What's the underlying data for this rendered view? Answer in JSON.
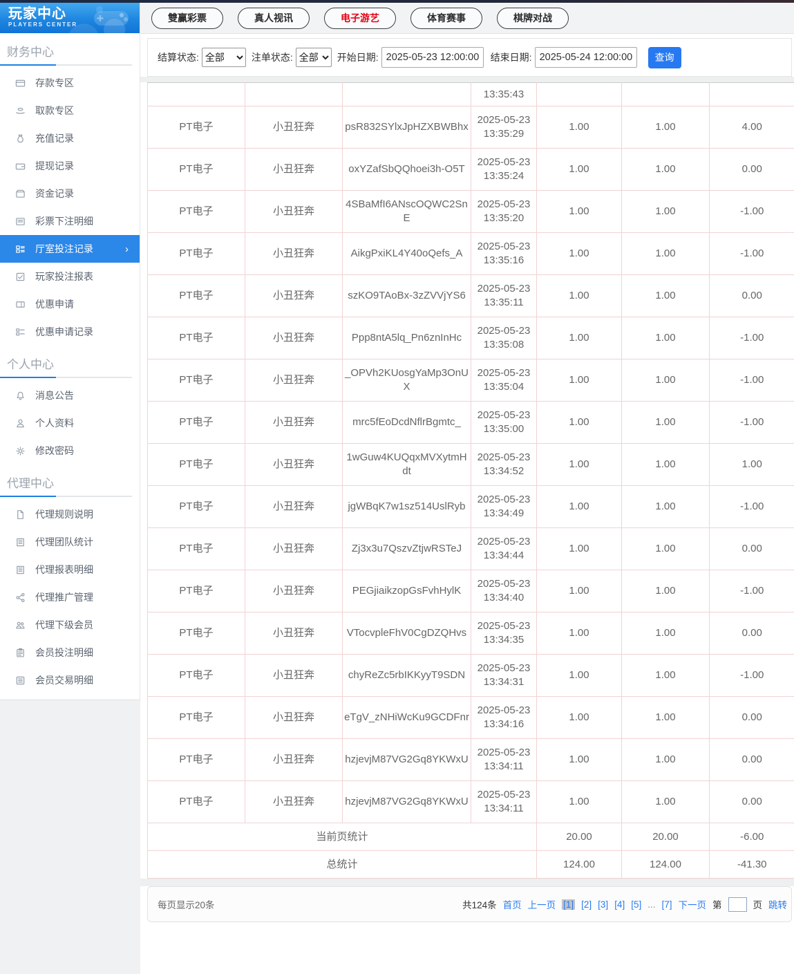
{
  "sidebar": {
    "title": "玩家中心",
    "subtitle": "PLAYERS CENTER",
    "sections": [
      {
        "title": "财务中心",
        "items": [
          {
            "name": "deposit-zone",
            "icon": "bank-card-icon",
            "label": "存款专区"
          },
          {
            "name": "withdraw-zone",
            "icon": "withdraw-hand-icon",
            "label": "取款专区"
          },
          {
            "name": "recharge-records",
            "icon": "money-bag-icon",
            "label": "充值记录"
          },
          {
            "name": "withdraw-records",
            "icon": "wallet-icon",
            "label": "提现记录"
          },
          {
            "name": "funds-records",
            "icon": "funds-icon",
            "label": "资金记录"
          },
          {
            "name": "lottery-bet-details",
            "icon": "lottery-list-icon",
            "label": "彩票下注明细"
          },
          {
            "name": "hall-bet-records",
            "icon": "hall-records-icon",
            "label": "厅室投注记录",
            "active": true
          },
          {
            "name": "player-bet-report",
            "icon": "report-icon",
            "label": "玩家投注报表"
          },
          {
            "name": "promo-apply",
            "icon": "coupon-icon",
            "label": "优惠申请"
          },
          {
            "name": "promo-apply-records",
            "icon": "coupon-record-icon",
            "label": "优惠申请记录"
          }
        ]
      },
      {
        "title": "个人中心",
        "items": [
          {
            "name": "messages",
            "icon": "bell-icon",
            "label": "消息公告"
          },
          {
            "name": "profile",
            "icon": "user-icon",
            "label": "个人资料"
          },
          {
            "name": "change-password",
            "icon": "gear-icon",
            "label": "修改密码"
          }
        ]
      },
      {
        "title": "代理中心",
        "items": [
          {
            "name": "agent-rules",
            "icon": "doc-icon",
            "label": "代理规则说明"
          },
          {
            "name": "agent-team-stats",
            "icon": "building-icon",
            "label": "代理团队统计"
          },
          {
            "name": "agent-report-details",
            "icon": "building-icon",
            "label": "代理报表明细"
          },
          {
            "name": "agent-promotion",
            "icon": "share-icon",
            "label": "代理推广管理"
          },
          {
            "name": "agent-sub-members",
            "icon": "users-icon",
            "label": "代理下级会员"
          },
          {
            "name": "member-bet-details",
            "icon": "clipboard-icon",
            "label": "会员投注明细"
          },
          {
            "name": "member-trade-details",
            "icon": "ledger-icon",
            "label": "会员交易明细"
          }
        ]
      }
    ]
  },
  "tabs": [
    {
      "name": "tab-lottery",
      "label": "雙赢彩票"
    },
    {
      "name": "tab-live-video",
      "label": "真人视讯"
    },
    {
      "name": "tab-electronic-games",
      "label": "电子游艺",
      "active": true
    },
    {
      "name": "tab-sports",
      "label": "体育赛事"
    },
    {
      "name": "tab-board-games",
      "label": "棋牌对战"
    }
  ],
  "filters": {
    "settle_label": "结算状态:",
    "settle_value": "全部",
    "order_label": "注单状态:",
    "order_value": "全部",
    "start_label": "开始日期:",
    "start_value": "2025-05-23 12:00:00",
    "end_label": "结束日期:",
    "end_value": "2025-05-24 12:00:00",
    "search_label": "查询"
  },
  "table": {
    "partial_row_time": "13:35:43",
    "rows": [
      {
        "game": "PT电子",
        "game_name": "小丑狂奔",
        "bet_id": "psR832SYlxJpHZXBWBhx",
        "date": "2025-05-23",
        "time": "13:35:29",
        "amount": "1.00",
        "valid_amount": "1.00",
        "win_loss": "4.00"
      },
      {
        "game": "PT电子",
        "game_name": "小丑狂奔",
        "bet_id": "oxYZafSbQQhoei3h-O5T",
        "date": "2025-05-23",
        "time": "13:35:24",
        "amount": "1.00",
        "valid_amount": "1.00",
        "win_loss": "0.00"
      },
      {
        "game": "PT电子",
        "game_name": "小丑狂奔",
        "bet_id": "4SBaMfI6ANscOQWC2SnE",
        "date": "2025-05-23",
        "time": "13:35:20",
        "amount": "1.00",
        "valid_amount": "1.00",
        "win_loss": "-1.00"
      },
      {
        "game": "PT电子",
        "game_name": "小丑狂奔",
        "bet_id": "AikgPxiKL4Y40oQefs_A",
        "date": "2025-05-23",
        "time": "13:35:16",
        "amount": "1.00",
        "valid_amount": "1.00",
        "win_loss": "-1.00"
      },
      {
        "game": "PT电子",
        "game_name": "小丑狂奔",
        "bet_id": "szKO9TAoBx-3zZVVjYS6",
        "date": "2025-05-23",
        "time": "13:35:11",
        "amount": "1.00",
        "valid_amount": "1.00",
        "win_loss": "0.00"
      },
      {
        "game": "PT电子",
        "game_name": "小丑狂奔",
        "bet_id": "Ppp8ntA5lq_Pn6znInHc",
        "date": "2025-05-23",
        "time": "13:35:08",
        "amount": "1.00",
        "valid_amount": "1.00",
        "win_loss": "-1.00"
      },
      {
        "game": "PT电子",
        "game_name": "小丑狂奔",
        "bet_id": "_OPVh2KUosgYaMp3OnUX",
        "date": "2025-05-23",
        "time": "13:35:04",
        "amount": "1.00",
        "valid_amount": "1.00",
        "win_loss": "-1.00"
      },
      {
        "game": "PT电子",
        "game_name": "小丑狂奔",
        "bet_id": "mrc5fEoDcdNflrBgmtc_",
        "date": "2025-05-23",
        "time": "13:35:00",
        "amount": "1.00",
        "valid_amount": "1.00",
        "win_loss": "-1.00"
      },
      {
        "game": "PT电子",
        "game_name": "小丑狂奔",
        "bet_id": "1wGuw4KUQqxMVXytmHdt",
        "date": "2025-05-23",
        "time": "13:34:52",
        "amount": "1.00",
        "valid_amount": "1.00",
        "win_loss": "1.00"
      },
      {
        "game": "PT电子",
        "game_name": "小丑狂奔",
        "bet_id": "jgWBqK7w1sz514UslRyb",
        "date": "2025-05-23",
        "time": "13:34:49",
        "amount": "1.00",
        "valid_amount": "1.00",
        "win_loss": "-1.00"
      },
      {
        "game": "PT电子",
        "game_name": "小丑狂奔",
        "bet_id": "Zj3x3u7QszvZtjwRSTeJ",
        "date": "2025-05-23",
        "time": "13:34:44",
        "amount": "1.00",
        "valid_amount": "1.00",
        "win_loss": "0.00"
      },
      {
        "game": "PT电子",
        "game_name": "小丑狂奔",
        "bet_id": "PEGjiaikzopGsFvhHylK",
        "date": "2025-05-23",
        "time": "13:34:40",
        "amount": "1.00",
        "valid_amount": "1.00",
        "win_loss": "-1.00"
      },
      {
        "game": "PT电子",
        "game_name": "小丑狂奔",
        "bet_id": "VTocvpleFhV0CgDZQHvs",
        "date": "2025-05-23",
        "time": "13:34:35",
        "amount": "1.00",
        "valid_amount": "1.00",
        "win_loss": "0.00"
      },
      {
        "game": "PT电子",
        "game_name": "小丑狂奔",
        "bet_id": "chyReZc5rbIKKyyT9SDN",
        "date": "2025-05-23",
        "time": "13:34:31",
        "amount": "1.00",
        "valid_amount": "1.00",
        "win_loss": "-1.00"
      },
      {
        "game": "PT电子",
        "game_name": "小丑狂奔",
        "bet_id": "eTgV_zNHiWcKu9GCDFnr",
        "date": "2025-05-23",
        "time": "13:34:16",
        "amount": "1.00",
        "valid_amount": "1.00",
        "win_loss": "0.00"
      },
      {
        "game": "PT电子",
        "game_name": "小丑狂奔",
        "bet_id": "hzjevjM87VG2Gq8YKWxU",
        "date": "2025-05-23",
        "time": "13:34:11",
        "amount": "1.00",
        "valid_amount": "1.00",
        "win_loss": "0.00"
      },
      {
        "game": "PT电子",
        "game_name": "小丑狂奔",
        "bet_id": "hzjevjM87VG2Gq8YKWxU",
        "date": "2025-05-23",
        "time": "13:34:11",
        "amount": "1.00",
        "valid_amount": "1.00",
        "win_loss": "0.00"
      }
    ],
    "summary": [
      {
        "label": "当前页统计",
        "amount": "20.00",
        "valid_amount": "20.00",
        "win_loss": "-6.00"
      },
      {
        "label": "总统计",
        "amount": "124.00",
        "valid_amount": "124.00",
        "win_loss": "-41.30"
      }
    ]
  },
  "pagination": {
    "page_size_text": "每页显示20条",
    "total_text": "共124条",
    "first_label": "首页",
    "prev_label": "上一页",
    "pages": [
      {
        "label": "[1]",
        "current": true
      },
      {
        "label": "[2]"
      },
      {
        "label": "[3]"
      },
      {
        "label": "[4]"
      },
      {
        "label": "[5]"
      },
      {
        "label": "...",
        "ellipsis": true
      },
      {
        "label": "[7]"
      }
    ],
    "next_label": "下一页",
    "jump_prefix": "第",
    "jump_suffix": "页",
    "jump_label": "跳转",
    "jump_value": ""
  },
  "colors": {
    "accent_blue": "#2b87e8",
    "link_blue": "#2a7cf0",
    "button_blue": "#2779f2",
    "tab_active_red": "#e60012",
    "table_border_pink": "#f1d3d3"
  }
}
